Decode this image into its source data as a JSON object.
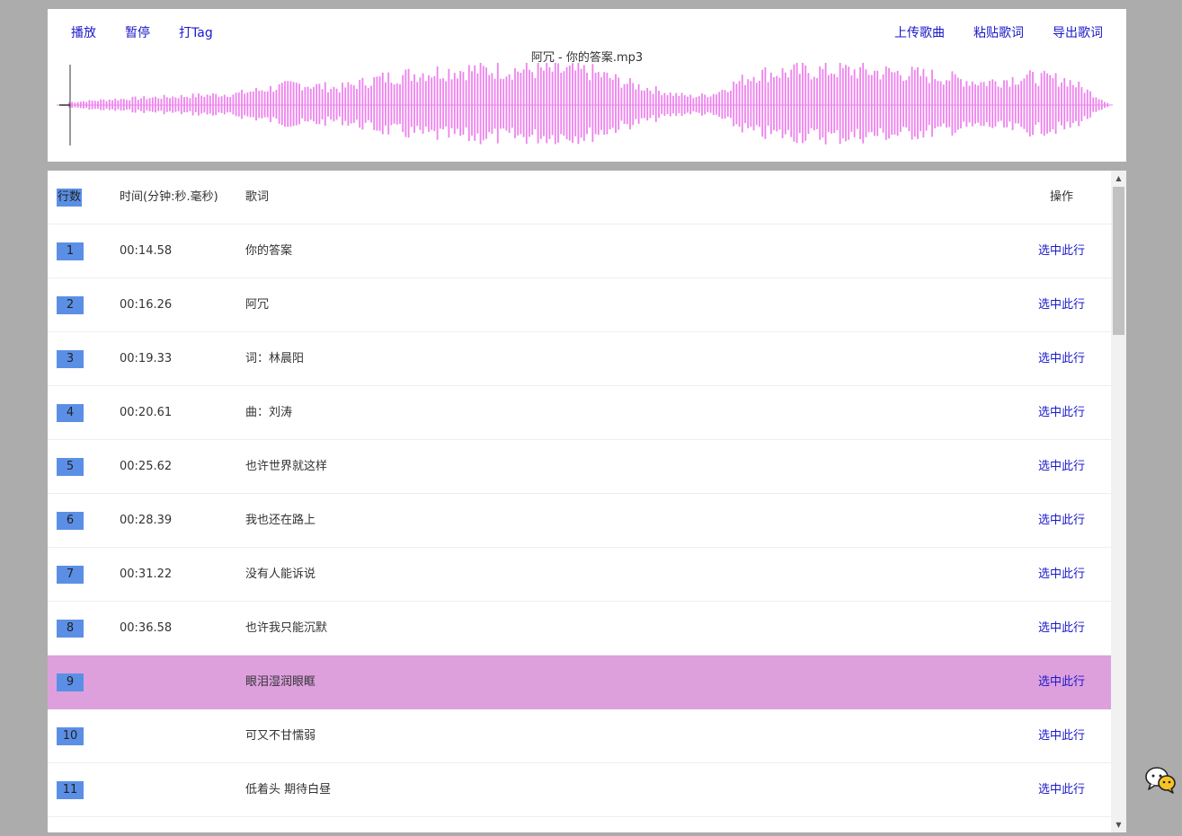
{
  "toolbar": {
    "left": [
      {
        "id": "play",
        "label": "播放"
      },
      {
        "id": "pause",
        "label": "暂停"
      },
      {
        "id": "tag",
        "label": "打Tag"
      }
    ],
    "right": [
      {
        "id": "upload",
        "label": "上传歌曲"
      },
      {
        "id": "paste",
        "label": "粘贴歌词"
      },
      {
        "id": "export",
        "label": "导出歌词"
      }
    ]
  },
  "song": {
    "title": "阿冗 - 你的答案.mp3"
  },
  "waveform": {
    "color": "#ee82ee",
    "playhead_position": 0
  },
  "table": {
    "headers": {
      "num": "行数",
      "time": "时间(分钟:秒.毫秒)",
      "lyric": "歌词",
      "op": "操作"
    },
    "rows": [
      {
        "num": "1",
        "time": "00:14.58",
        "lyric": "你的答案",
        "op": "选中此行"
      },
      {
        "num": "2",
        "time": "00:16.26",
        "lyric": "阿冗",
        "op": "选中此行"
      },
      {
        "num": "3",
        "time": "00:19.33",
        "lyric": "词：林晨阳",
        "op": "选中此行"
      },
      {
        "num": "4",
        "time": "00:20.61",
        "lyric": "曲：刘涛",
        "op": "选中此行"
      },
      {
        "num": "5",
        "time": "00:25.62",
        "lyric": "也许世界就这样",
        "op": "选中此行"
      },
      {
        "num": "6",
        "time": "00:28.39",
        "lyric": "我也还在路上",
        "op": "选中此行"
      },
      {
        "num": "7",
        "time": "00:31.22",
        "lyric": "没有人能诉说",
        "op": "选中此行"
      },
      {
        "num": "8",
        "time": "00:36.58",
        "lyric": "也许我只能沉默",
        "op": "选中此行"
      },
      {
        "num": "9",
        "time": "",
        "lyric": "眼泪湿润眼眶",
        "op": "选中此行",
        "active": true
      },
      {
        "num": "10",
        "time": "",
        "lyric": "可又不甘懦弱",
        "op": "选中此行"
      },
      {
        "num": "11",
        "time": "",
        "lyric": "低着头 期待白昼",
        "op": "选中此行"
      }
    ]
  },
  "colors": {
    "badge": "#5b8fe6",
    "active_row": "#dda0dd",
    "link": "#1a19c9",
    "background": "#acacac"
  },
  "icons": {
    "chat": "wechat-chat-icon",
    "scroll_up": "scroll-up-arrow-icon",
    "scroll_down": "scroll-down-arrow-icon"
  }
}
